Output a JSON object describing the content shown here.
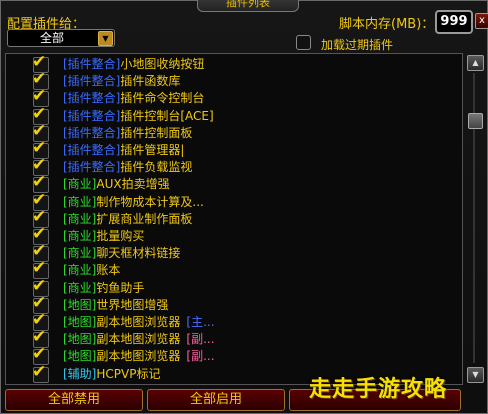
{
  "window": {
    "title": "插件列表",
    "close_label": "x"
  },
  "header": {
    "config_label": "配置插件给：",
    "config_value": "全部",
    "memory_label": "脚本内存(MB)：",
    "memory_value": "999",
    "load_expired_label": "加载过期插件",
    "load_expired_checked": false
  },
  "list": {
    "items": [
      {
        "category": "[插件整合]",
        "name": "小地图收纳按钮",
        "suffix": "",
        "checked": true,
        "cat_color": "blue",
        "name_color": "gold"
      },
      {
        "category": "[插件整合]",
        "name": "插件函数库",
        "suffix": "",
        "checked": true,
        "cat_color": "blue",
        "name_color": "gold"
      },
      {
        "category": "[插件整合]",
        "name": "插件命令控制台",
        "suffix": "",
        "checked": true,
        "cat_color": "blue",
        "name_color": "gold"
      },
      {
        "category": "[插件整合]",
        "name": "插件控制台[ACE]",
        "suffix": "",
        "checked": true,
        "cat_color": "blue",
        "name_color": "gold"
      },
      {
        "category": "[插件整合]",
        "name": "插件控制面板",
        "suffix": "",
        "checked": true,
        "cat_color": "blue",
        "name_color": "gold"
      },
      {
        "category": "[插件整合]",
        "name": "插件管理器|",
        "suffix": "",
        "checked": true,
        "cat_color": "blue",
        "name_color": "gold"
      },
      {
        "category": "[插件整合]",
        "name": "插件负载监视",
        "suffix": "",
        "checked": true,
        "cat_color": "blue",
        "name_color": "gold"
      },
      {
        "category": "[商业]",
        "name": "AUX拍卖增强",
        "suffix": "",
        "checked": true,
        "cat_color": "green",
        "name_color": "gold"
      },
      {
        "category": "[商业]",
        "name": "制作物成本计算及...",
        "suffix": "",
        "checked": true,
        "cat_color": "green",
        "name_color": "gold"
      },
      {
        "category": "[商业]",
        "name": "扩展商业制作面板",
        "suffix": "",
        "checked": true,
        "cat_color": "green",
        "name_color": "gold"
      },
      {
        "category": "[商业]",
        "name": "批量购买",
        "suffix": "",
        "checked": true,
        "cat_color": "green",
        "name_color": "gold"
      },
      {
        "category": "[商业]",
        "name": "聊天框材料链接",
        "suffix": "",
        "checked": true,
        "cat_color": "green",
        "name_color": "gold"
      },
      {
        "category": "[商业]",
        "name": "账本",
        "suffix": "",
        "checked": true,
        "cat_color": "green",
        "name_color": "gold"
      },
      {
        "category": "[商业]",
        "name": "钓鱼助手",
        "suffix": "",
        "checked": true,
        "cat_color": "green",
        "name_color": "gold"
      },
      {
        "category": "[地图]",
        "name": "世界地图增强",
        "suffix": "",
        "checked": true,
        "cat_color": "green",
        "name_color": "gold"
      },
      {
        "category": "[地图]",
        "name": "副本地图浏览器",
        "suffix": "[主...",
        "checked": true,
        "cat_color": "green",
        "name_color": "gold",
        "suffix_color": "blue"
      },
      {
        "category": "[地图]",
        "name": "副本地图浏览器",
        "suffix": "[副...",
        "checked": true,
        "cat_color": "green",
        "name_color": "gold",
        "suffix_color": "red"
      },
      {
        "category": "[地图]",
        "name": "副本地图浏览器",
        "suffix": "[副...",
        "checked": true,
        "cat_color": "green",
        "name_color": "gold",
        "suffix_color": "red"
      },
      {
        "category": "[辅助]",
        "name": "HCPVP标记",
        "suffix": "",
        "checked": true,
        "cat_color": "cyan",
        "name_color": "gold"
      }
    ]
  },
  "footer": {
    "disable_all_label": "全部禁用",
    "enable_all_label": "全部启用",
    "watermark": "走走手游攻略"
  }
}
